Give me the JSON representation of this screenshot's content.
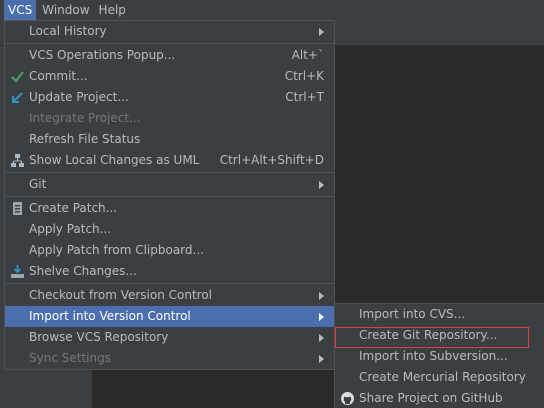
{
  "menubar": {
    "items": [
      "VCS",
      "Window",
      "Help"
    ]
  },
  "vcs_menu": {
    "local_history": "Local History",
    "vcs_operations_popup": "VCS Operations Popup...",
    "vcs_operations_popup_sc": "Alt+`",
    "commit": "Commit...",
    "commit_sc": "Ctrl+K",
    "update_project": "Update Project...",
    "update_project_sc": "Ctrl+T",
    "integrate_project": "Integrate Project...",
    "refresh_file_status": "Refresh File Status",
    "show_local_changes_uml": "Show Local Changes as UML",
    "show_local_changes_uml_sc": "Ctrl+Alt+Shift+D",
    "git": "Git",
    "create_patch": "Create Patch...",
    "apply_patch": "Apply Patch...",
    "apply_patch_clipboard": "Apply Patch from Clipboard...",
    "shelve_changes": "Shelve Changes...",
    "checkout_vc": "Checkout from Version Control",
    "import_vc": "Import into Version Control",
    "browse_vcs_repo": "Browse VCS Repository",
    "sync_settings": "Sync Settings"
  },
  "import_submenu": {
    "import_cvs": "Import into CVS...",
    "create_git_repo": "Create Git Repository...",
    "import_svn": "Import into Subversion...",
    "create_hg_repo": "Create Mercurial Repository",
    "share_github": "Share Project on GitHub"
  },
  "colors": {
    "selection": "#4b6eaf",
    "menu_bg": "#3c3f41",
    "highlight_box": "#e04040",
    "commit_check": "#4c9e5f",
    "update_arrow": "#3592c4"
  },
  "icons": [
    "commit-check-icon",
    "update-arrow-icon",
    "uml-diagram-icon",
    "patch-icon",
    "shelve-icon",
    "github-icon"
  ]
}
